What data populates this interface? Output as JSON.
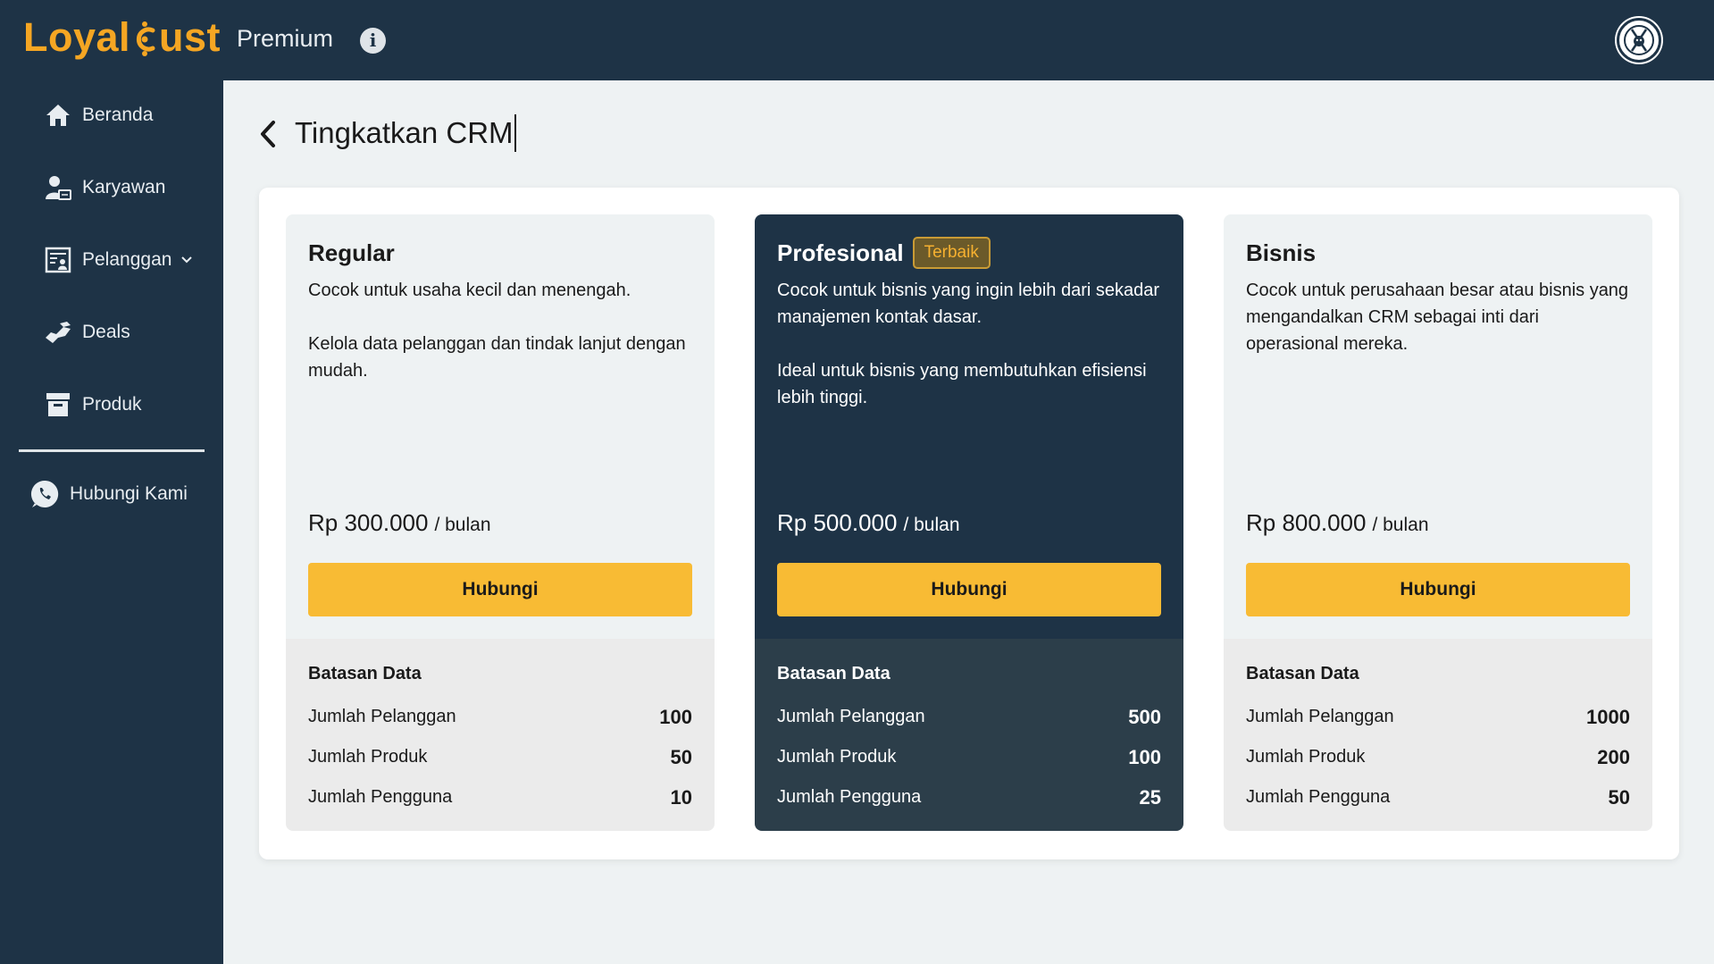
{
  "app": {
    "logo_text_1": "Loyal",
    "logo_text_2": "ust",
    "plan_name": "Premium"
  },
  "sidebar": {
    "items": [
      {
        "label": "Beranda",
        "icon": "home-icon"
      },
      {
        "label": "Karyawan",
        "icon": "employee-icon"
      },
      {
        "label": "Pelanggan",
        "icon": "customer-card-icon"
      },
      {
        "label": "Deals",
        "icon": "handshake-icon"
      },
      {
        "label": "Produk",
        "icon": "archive-box-icon"
      },
      {
        "label": "Hubungi Kami",
        "icon": "whatsapp-icon"
      }
    ]
  },
  "page": {
    "title": "Tingkatkan CRM"
  },
  "plans": [
    {
      "name": "Regular",
      "badge": "",
      "description": "Cocok untuk usaha kecil dan menengah.\n\nKelola data pelanggan dan tindak lanjut dengan mudah.",
      "price": "Rp 300.000",
      "period": "bulan",
      "cta": "Hubungi",
      "limits_title": "Batasan Data",
      "limits": [
        {
          "label": "Jumlah Pelanggan",
          "value": "100"
        },
        {
          "label": "Jumlah Produk",
          "value": "50"
        },
        {
          "label": "Jumlah Pengguna",
          "value": "10"
        }
      ]
    },
    {
      "name": "Profesional",
      "badge": "Terbaik",
      "description": "Cocok untuk bisnis yang ingin lebih dari sekadar manajemen kontak dasar.\n\nIdeal untuk bisnis yang membutuhkan efisiensi lebih tinggi.",
      "price": "Rp 500.000",
      "period": "bulan",
      "cta": "Hubungi",
      "limits_title": "Batasan Data",
      "limits": [
        {
          "label": "Jumlah Pelanggan",
          "value": "500"
        },
        {
          "label": "Jumlah Produk",
          "value": "100"
        },
        {
          "label": "Jumlah Pengguna",
          "value": "25"
        }
      ]
    },
    {
      "name": "Bisnis",
      "badge": "",
      "description": "Cocok untuk perusahaan besar atau bisnis yang mengandalkan CRM sebagai inti dari operasional mereka.",
      "price": "Rp 800.000",
      "period": "bulan",
      "cta": "Hubungi",
      "limits_title": "Batasan Data",
      "limits": [
        {
          "label": "Jumlah Pelanggan",
          "value": "1000"
        },
        {
          "label": "Jumlah Produk",
          "value": "200"
        },
        {
          "label": "Jumlah Pengguna",
          "value": "50"
        }
      ]
    }
  ],
  "colors": {
    "sidebar_bg": "#1e3346",
    "accent": "#f8bb34",
    "logo": "#f5a623",
    "page_bg": "#eef2f3"
  }
}
